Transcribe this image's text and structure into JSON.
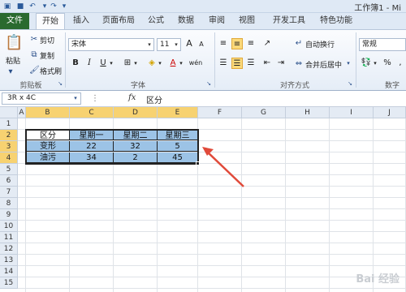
{
  "titlebar": {
    "app_title": "工作簿1 - Mi",
    "qat": [
      "save-icon",
      "undo-icon",
      "redo-icon",
      "customize-icon"
    ]
  },
  "tabs": [
    {
      "label": "文件"
    },
    {
      "label": "开始"
    },
    {
      "label": "插入"
    },
    {
      "label": "页面布局"
    },
    {
      "label": "公式"
    },
    {
      "label": "数据"
    },
    {
      "label": "审阅"
    },
    {
      "label": "视图"
    },
    {
      "label": "开发工具"
    },
    {
      "label": "特色功能"
    }
  ],
  "ribbon": {
    "clipboard": {
      "paste": "粘贴",
      "cut": "剪切",
      "copy": "复制",
      "format_painter": "格式刷",
      "label": "剪贴板"
    },
    "font": {
      "font_name": "宋体",
      "font_size": "11",
      "bold": "B",
      "italic": "I",
      "underline": "U",
      "label": "字体",
      "wen": "wén"
    },
    "alignment": {
      "wrap": "自动换行",
      "merge": "合并后居中",
      "label": "对齐方式"
    },
    "number": {
      "format": "常规",
      "percent": "%",
      "label": "数字"
    }
  },
  "formula_bar": {
    "name_box": "3R x 4C",
    "fx": "fx",
    "content": "区分"
  },
  "columns": [
    "A",
    "B",
    "C",
    "D",
    "E",
    "F",
    "G",
    "H",
    "I",
    "J"
  ],
  "rows": [
    "1",
    "2",
    "3",
    "4",
    "5",
    "6",
    "7",
    "8",
    "9",
    "10",
    "11",
    "12",
    "13",
    "14",
    "15"
  ],
  "table": [
    [
      "区分",
      "星期一",
      "星期二",
      "星期三"
    ],
    [
      "变形",
      "22",
      "32",
      "5"
    ],
    [
      "油污",
      "34",
      "2",
      "45"
    ]
  ],
  "watermark": "Bai 经验",
  "colors": {
    "selection": "#9cc3e6",
    "header_selected": "#f7d271",
    "file_tab": "#2a6a2f",
    "arrow": "#e04a3a"
  }
}
